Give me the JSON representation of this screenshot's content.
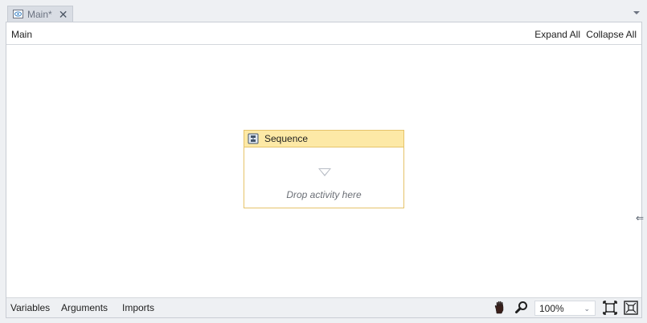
{
  "tab": {
    "label": "Main*",
    "close_glyph": "✕",
    "icon": "workflow-icon"
  },
  "header": {
    "breadcrumb": "Main",
    "expand_all": "Expand All",
    "collapse_all": "Collapse All"
  },
  "sequence": {
    "title": "Sequence",
    "placeholder": "Drop activity here",
    "icon": "sequence-icon"
  },
  "side_arrow_glyph": "⇐",
  "footer": {
    "variables": "Variables",
    "arguments": "Arguments",
    "imports": "Imports",
    "zoom": "100%",
    "zoom_chevron": "⌄",
    "icons": [
      "pan-hand-icon",
      "zoom-magnifier-icon",
      "fit-to-screen-icon",
      "overview-icon"
    ]
  },
  "colors": {
    "sequence_header": "#fde9a6",
    "sequence_border": "#e6c36a",
    "canvas": "#ffffff",
    "chrome": "#eef0f3"
  }
}
